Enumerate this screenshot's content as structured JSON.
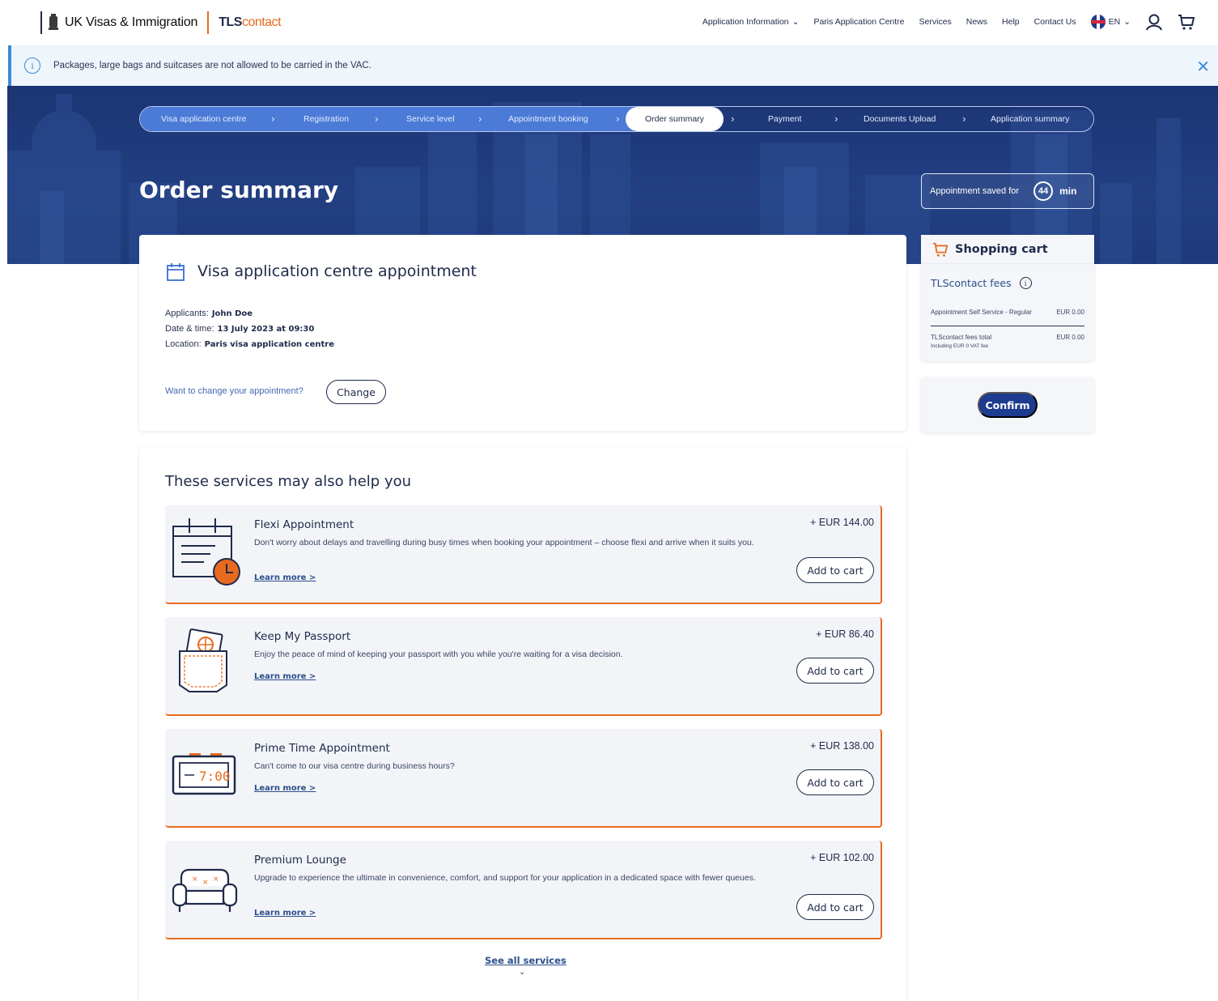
{
  "header": {
    "gov_brand": "UK Visas & Immigration",
    "tls_brand_bold": "TLS",
    "tls_brand_light": "contact",
    "nav": [
      "Application Information",
      "Paris Application Centre",
      "Services",
      "News",
      "Help",
      "Contact Us"
    ],
    "lang": "EN"
  },
  "banner": {
    "text": "Packages, large bags and suitcases are not allowed to be carried in the VAC."
  },
  "stepper": {
    "steps": [
      "Visa application centre",
      "Registration",
      "Service level",
      "Appointment booking",
      "Order summary",
      "Payment",
      "Documents Upload",
      "Application summary"
    ],
    "active": "Order summary"
  },
  "page": {
    "title": "Order summary"
  },
  "timer": {
    "label": "Appointment saved for",
    "value": "44",
    "unit": "min"
  },
  "appointment": {
    "title": "Visa application centre appointment",
    "applicants_label": "Applicants:",
    "applicants_value": "John Doe",
    "datetime_label": "Date & time:",
    "datetime_value": "13 July 2023 at 09:30",
    "location_label": "Location:",
    "location_value": "Paris visa application centre",
    "change_question": "Want to change your appointment?",
    "change_button": "Change"
  },
  "cart": {
    "title": "Shopping cart",
    "fees_title": "TLScontact fees",
    "line_label": "Appointment Self Service - Regular",
    "line_value": "EUR 0.00",
    "total_label": "TLScontact fees total",
    "total_value": "EUR 0.00",
    "vat_note": "Including EUR 0 VAT fee",
    "confirm_button": "Confirm"
  },
  "services": {
    "title": "These services may also help you",
    "learn_more": "Learn more >",
    "add_to_cart": "Add to cart",
    "items": [
      {
        "name": "Flexi Appointment",
        "price": "+ EUR 144.00",
        "desc": "Don't worry about delays and travelling during busy times when booking your appointment – choose flexi and arrive when it suits you.",
        "icon": "flexi-appointment-icon"
      },
      {
        "name": "Keep My Passport",
        "price": "+ EUR 86.40",
        "desc": "Enjoy the peace of mind of keeping your passport with you while you're waiting for a visa decision.",
        "icon": "passport-pocket-icon"
      },
      {
        "name": "Prime Time Appointment",
        "price": "+ EUR 138.00",
        "desc": "Can't come to our visa centre during business hours?",
        "icon": "alarm-clock-icon"
      },
      {
        "name": "Premium Lounge",
        "price": "+ EUR 102.00",
        "desc": "Upgrade to experience the ultimate in convenience, comfort, and support for your application in a dedicated space with fewer queues.",
        "icon": "sofa-icon"
      }
    ],
    "see_all": "See all services"
  },
  "colors": {
    "navy": "#1f2a4a",
    "accent_orange": "#e86a1f",
    "primary_blue": "#1d3b8f",
    "info_blue": "#3b8ad9"
  }
}
